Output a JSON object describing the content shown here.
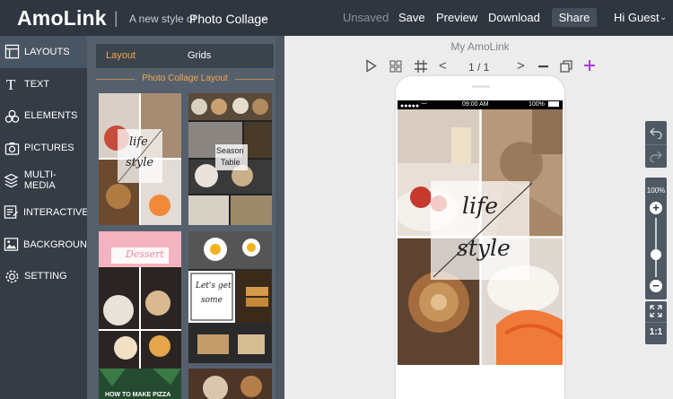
{
  "header": {
    "logo": "AmoLink",
    "divider": "|",
    "tagline": "A new style of",
    "product": "Photo Collage",
    "nav_unsaved": "Unsaved",
    "nav_save": "Save",
    "nav_preview": "Preview",
    "nav_download": "Download",
    "nav_share": "Share",
    "user_greeting": "Hi Guest"
  },
  "sidebar": {
    "items": [
      {
        "label": "LAYOUTS",
        "icon": "layouts-icon"
      },
      {
        "label": "TEXT",
        "icon": "text-icon"
      },
      {
        "label": "ELEMENTS",
        "icon": "elements-icon"
      },
      {
        "label": "PICTURES",
        "icon": "pictures-icon"
      },
      {
        "label": "MULTI-MEDIA",
        "icon": "multimedia-icon"
      },
      {
        "label": "INTERACTIVE",
        "icon": "interactive-icon"
      },
      {
        "label": "BACKGROUND",
        "icon": "background-icon"
      },
      {
        "label": "SETTING",
        "icon": "setting-icon"
      }
    ]
  },
  "panel": {
    "tab_layout": "Layout",
    "tab_grids": "Grids",
    "section_title": "Photo Collage Layout",
    "thumbs": [
      {
        "line1": "life",
        "line2": "style"
      },
      {
        "line1": "Season",
        "line2": "Table"
      },
      {
        "line1": "Dessert",
        "line2": ""
      },
      {
        "line1": "Let's get",
        "line2": "some"
      },
      {
        "line1": "HOW TO MAKE PIZZA",
        "line2": ""
      }
    ]
  },
  "canvas": {
    "title": "My AmoLink",
    "page_indicator": "1 / 1",
    "status_time": "09:00 AM",
    "status_battery": "100%",
    "collage_text_1": "life",
    "collage_text_2": "style"
  },
  "right_controls": {
    "zoom_label": "100%",
    "ratio_label": "1:1"
  },
  "colors": {
    "accent_orange": "#f2a650",
    "accent_purple": "#b03ad8",
    "topbar": "#2f3640",
    "sidebar": "#353c46"
  }
}
